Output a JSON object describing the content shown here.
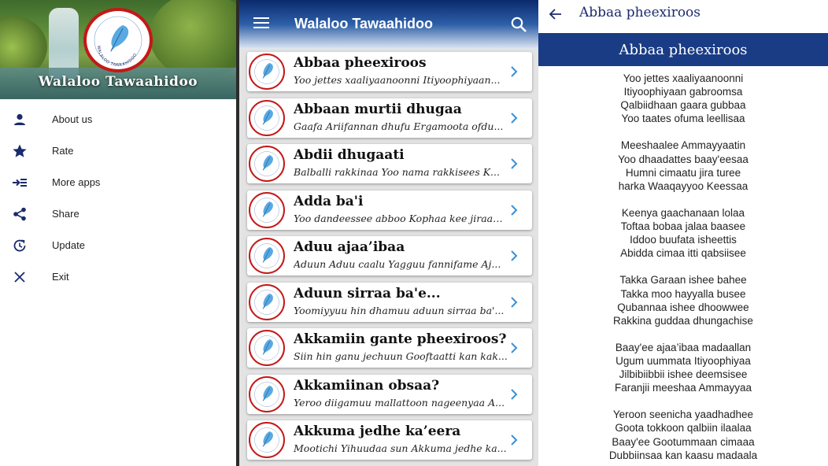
{
  "drawer": {
    "app_title": "Walaloo Tawaahidoo",
    "logo_text": "WALALOO TAWAAHIDOO",
    "menu": [
      {
        "label": "About us",
        "icon": "person-icon"
      },
      {
        "label": "Rate",
        "icon": "star-icon"
      },
      {
        "label": "More apps",
        "icon": "more-apps-icon"
      },
      {
        "label": "Share",
        "icon": "share-icon"
      },
      {
        "label": "Update",
        "icon": "update-icon"
      },
      {
        "label": "Exit",
        "icon": "close-icon"
      }
    ]
  },
  "list_screen": {
    "title": "Walaloo Tawaahidoo",
    "items": [
      {
        "title": "Abbaa pheexiroos",
        "subtitle": "Yoo jettes xaaliyaanoonni Itiyoophiyaan..."
      },
      {
        "title": "Abbaan murtii dhugaa",
        "subtitle": "Gaafa Ariifannan dhufu Ergamoota ofdu..."
      },
      {
        "title": "Abdii dhugaati",
        "subtitle": "Balballi rakkinaa Yoo nama rakkisees K..."
      },
      {
        "title": "Adda ba'i",
        "subtitle": "Yoo dandeessee abboo Kophaa kee jiraad..."
      },
      {
        "title": "Aduu ajaa’ibaa",
        "subtitle": "Aduun Aduu caalu Yagguu fannifame Aj..."
      },
      {
        "title": "Aduun sirraa ba'e...",
        "subtitle": "Yoomiyyuu hin dhamuu aduun sirraa ba'..."
      },
      {
        "title": "Akkamiin gante pheexiroos?",
        "subtitle": "Siin hin ganu jechuun Gooftaatti kan kak..."
      },
      {
        "title": "Akkamiinan obsaa?",
        "subtitle": "Yeroo diigamuu mallattoon nageenyaa A..."
      },
      {
        "title": "Akkuma jedhe ka’eera",
        "subtitle": "Mootichi Yihuudaa sun Akkuma jedhe ka..."
      }
    ]
  },
  "detail_screen": {
    "title": "Abbaa pheexiroos",
    "banner": "Abbaa pheexiroos",
    "stanzas": [
      [
        "Yoo jettes xaaliyaanoonni",
        "Itiyoophiyaan gabroomsa",
        "Qalbiidhaan gaara gubbaa",
        "Yoo taates ofuma leellisaa"
      ],
      [
        "Meeshaalee Ammayyaatin",
        "Yoo dhaadattes baay'eesaa",
        "Humni cimaatu jira turee",
        "harka Waaqayyoo Keessaa"
      ],
      [
        "Keenya gaachanaan lolaa",
        "Toftaa bobaa jalaa baasee",
        "Iddoo buufata isheettis",
        "Abidda cimaa itti qabsiisee"
      ],
      [
        "Takka Garaan ishee bahee",
        "Takka moo hayyalla busee",
        "Qubannaa ishee dhoowwee",
        "Rakkina guddaa dhungachise"
      ],
      [
        "Baay'ee ajaa’ibaa madaallan",
        "Ugum uummata Itiyoophiyaa",
        "Jilbibiibbii ishee deemsisee",
        "Faranjii meeshaa Ammayyaa"
      ],
      [
        "Yeroon seenicha yaadhadhee",
        "Goota tokkoon qalbiin ilaalaa",
        "Baay'ee Gootummaan cimaaa",
        "Dubbiinsaa kan kaasu madaala"
      ]
    ]
  },
  "colors": {
    "navy": "#1a2b6d",
    "banner": "#1a3c84",
    "logo_ring": "#c41818",
    "chevron": "#3a8fd6"
  }
}
